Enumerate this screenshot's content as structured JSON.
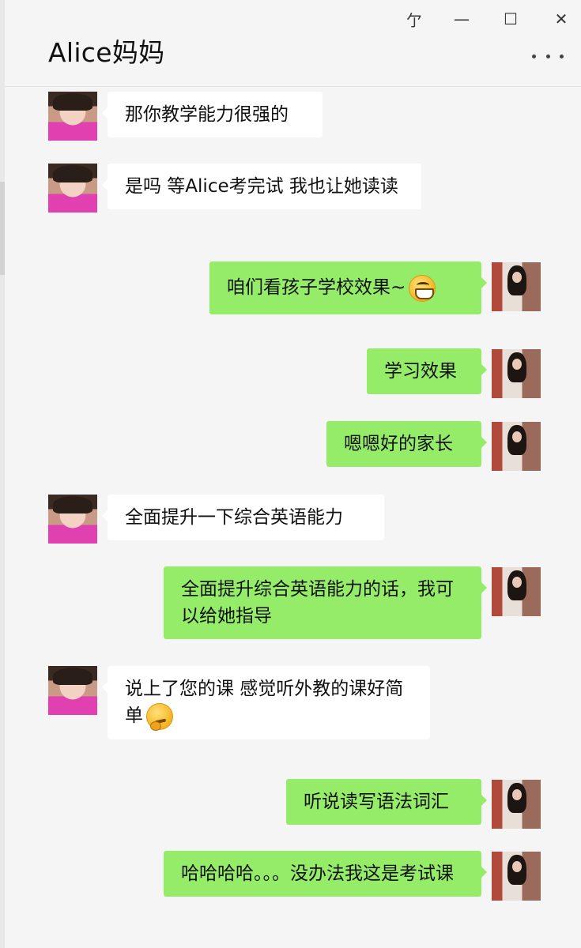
{
  "window": {
    "title": "Alice妈妈",
    "pin_glyph": "亇",
    "minimize_glyph": "—",
    "maximize_glyph": "☐",
    "close_glyph": "✕",
    "more_icon": "more-dots-icon"
  },
  "messages": [
    {
      "from": "contact",
      "text": "那你教学能力很强的"
    },
    {
      "from": "contact",
      "text": "是吗 等Alice考完试 我也让她读读"
    },
    {
      "from": "me",
      "text": "咱们看孩子学校效果~",
      "emoji": "grin-emoji-icon"
    },
    {
      "from": "me",
      "text": "学习效果"
    },
    {
      "from": "me",
      "text": "嗯嗯好的家长"
    },
    {
      "from": "contact",
      "text": "全面提升一下综合英语能力"
    },
    {
      "from": "me",
      "text": "全面提升综合英语能力的话，我可以给她指导"
    },
    {
      "from": "contact",
      "text": "说上了您的课 感觉听外教的课好简单",
      "emoji": "thinking-emoji-icon"
    },
    {
      "from": "me",
      "text": "听说读写语法词汇"
    },
    {
      "from": "me",
      "text": "哈哈哈哈。。。没办法我这是考试课"
    }
  ],
  "colors": {
    "background": "#f5f5f5",
    "incoming_bubble": "#ffffff",
    "outgoing_bubble": "#95ec69"
  }
}
